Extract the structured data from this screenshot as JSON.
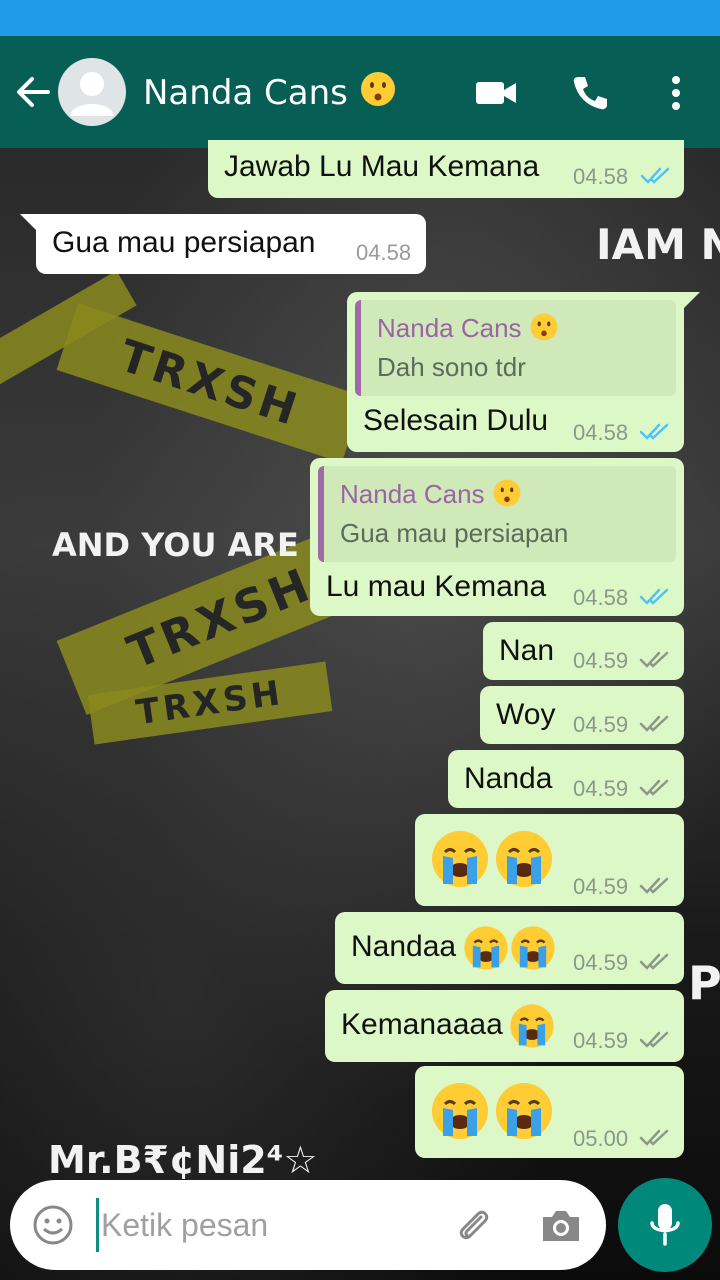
{
  "header": {
    "contact_name": "Nanda Cans",
    "contact_emoji": "kissing-face",
    "actions": [
      "video-call-icon",
      "voice-call-icon",
      "more-options-icon"
    ]
  },
  "messages": [
    {
      "direction": "out",
      "text": "Jawab Lu Mau Kemana",
      "time": "04.58",
      "status": "read"
    },
    {
      "direction": "in",
      "text": "Gua mau persiapan",
      "time": "04.58"
    },
    {
      "direction": "out",
      "text": "Selesain Dulu",
      "time": "04.58",
      "status": "read",
      "quote": {
        "author": "Nanda Cans",
        "text": "Dah sono tdr"
      }
    },
    {
      "direction": "out",
      "text": "Lu mau Kemana",
      "time": "04.58",
      "status": "read",
      "quote": {
        "author": "Nanda Cans",
        "text": "Gua mau persiapan"
      }
    },
    {
      "direction": "out",
      "text": "Nan",
      "time": "04.59",
      "status": "delivered"
    },
    {
      "direction": "out",
      "text": "Woy",
      "time": "04.59",
      "status": "delivered"
    },
    {
      "direction": "out",
      "text": "Nanda",
      "time": "04.59",
      "status": "delivered"
    },
    {
      "direction": "out",
      "text": "",
      "emoji": [
        "crying-face",
        "crying-face"
      ],
      "time": "04.59",
      "status": "delivered"
    },
    {
      "direction": "out",
      "text": "Nandaa",
      "emoji": [
        "crying-face",
        "crying-face"
      ],
      "time": "04.59",
      "status": "delivered"
    },
    {
      "direction": "out",
      "text": "Kemanaaaa",
      "emoji": [
        "crying-face"
      ],
      "time": "04.59",
      "status": "delivered"
    },
    {
      "direction": "out",
      "text": "",
      "emoji": [
        "crying-face",
        "crying-face"
      ],
      "time": "05.00",
      "status": "delivered"
    }
  ],
  "wallpaper": {
    "tape_text": "TRXSH",
    "texts": [
      "IAM N",
      "AND YOU ARE PR",
      "P",
      "Mr.B₹¢Ni2⁴☆"
    ]
  },
  "composer": {
    "placeholder": "Ketik pesan",
    "icons": [
      "emoji-icon",
      "attach-icon",
      "camera-icon",
      "mic-icon"
    ]
  },
  "colors": {
    "status_bar": "#1e9be9",
    "app_bar": "#075e54",
    "outgoing_bubble": "#dcf8c6",
    "incoming_bubble": "#ffffff",
    "read_ticks": "#4fc3f7",
    "delivered_ticks": "#8b978b",
    "mic_button": "#00897b"
  }
}
